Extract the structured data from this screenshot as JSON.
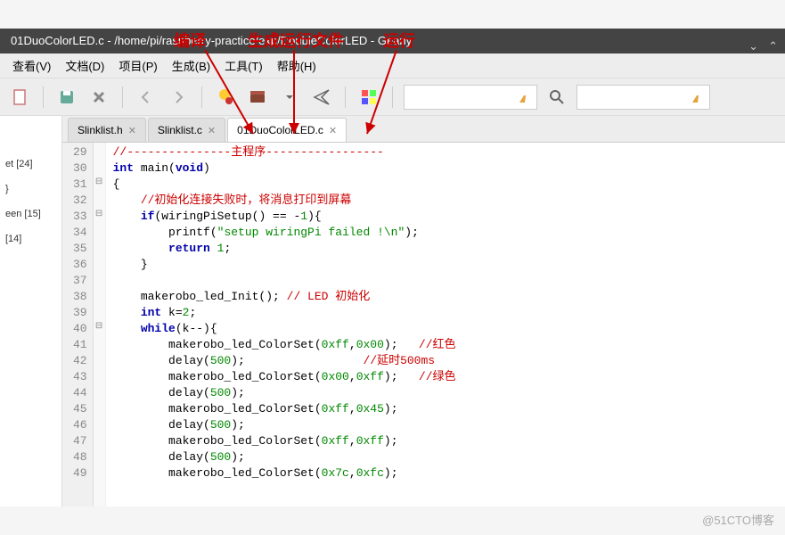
{
  "annotations": {
    "compile": "编译",
    "build": "生成运行文件",
    "run": "运行"
  },
  "titlebar": "01DuoColorLED.c - /home/pi/raspberry-practice/exp/DoubleColorLED - Geany",
  "menu": {
    "view": "查看(V)",
    "doc": "文档(D)",
    "project": "项目(P)",
    "build": "生成(B)",
    "tools": "工具(T)",
    "help": "帮助(H)"
  },
  "sidebar": {
    "items": [
      "et [24]",
      "}",
      "een [15]",
      " [14]"
    ]
  },
  "tabs": [
    {
      "label": "Slinklist.h",
      "active": false
    },
    {
      "label": "Slinklist.c",
      "active": false
    },
    {
      "label": "01DuoColorLED.c",
      "active": true
    }
  ],
  "code": {
    "start": 29,
    "lines": [
      {
        "fold": "",
        "seg": [
          {
            "c": "cm",
            "t": "//---------------主程序-----------------"
          }
        ]
      },
      {
        "fold": "",
        "seg": [
          {
            "c": "kw",
            "t": "int"
          },
          {
            "c": "",
            "t": " main("
          },
          {
            "c": "kw",
            "t": "void"
          },
          {
            "c": "",
            "t": ")"
          }
        ]
      },
      {
        "fold": "⊟",
        "seg": [
          {
            "c": "",
            "t": "{"
          }
        ]
      },
      {
        "fold": "",
        "seg": [
          {
            "c": "",
            "t": "    "
          },
          {
            "c": "cm",
            "t": "//初始化连接失败时，将消息打印到屏幕"
          }
        ]
      },
      {
        "fold": "⊟",
        "seg": [
          {
            "c": "",
            "t": "    "
          },
          {
            "c": "kw",
            "t": "if"
          },
          {
            "c": "",
            "t": "(wiringPiSetup() == -"
          },
          {
            "c": "num",
            "t": "1"
          },
          {
            "c": "",
            "t": "){"
          }
        ]
      },
      {
        "fold": "",
        "seg": [
          {
            "c": "",
            "t": "        printf("
          },
          {
            "c": "str",
            "t": "\"setup wiringPi failed !\\n\""
          },
          {
            "c": "",
            "t": ");"
          }
        ]
      },
      {
        "fold": "",
        "seg": [
          {
            "c": "",
            "t": "        "
          },
          {
            "c": "kw",
            "t": "return"
          },
          {
            "c": "",
            "t": " "
          },
          {
            "c": "num",
            "t": "1"
          },
          {
            "c": "",
            "t": ";"
          }
        ]
      },
      {
        "fold": "",
        "seg": [
          {
            "c": "",
            "t": "    }"
          }
        ]
      },
      {
        "fold": "",
        "seg": [
          {
            "c": "",
            "t": ""
          }
        ]
      },
      {
        "fold": "",
        "seg": [
          {
            "c": "",
            "t": "    makerobo_led_Init(); "
          },
          {
            "c": "cm",
            "t": "// LED 初始化"
          }
        ]
      },
      {
        "fold": "",
        "seg": [
          {
            "c": "",
            "t": "    "
          },
          {
            "c": "kw",
            "t": "int"
          },
          {
            "c": "",
            "t": " k="
          },
          {
            "c": "num",
            "t": "2"
          },
          {
            "c": "",
            "t": ";"
          }
        ]
      },
      {
        "fold": "⊟",
        "seg": [
          {
            "c": "",
            "t": "    "
          },
          {
            "c": "kw",
            "t": "while"
          },
          {
            "c": "",
            "t": "(k--){"
          }
        ]
      },
      {
        "fold": "",
        "seg": [
          {
            "c": "",
            "t": "        makerobo_led_ColorSet("
          },
          {
            "c": "num",
            "t": "0xff"
          },
          {
            "c": "",
            "t": ","
          },
          {
            "c": "num",
            "t": "0x00"
          },
          {
            "c": "",
            "t": ");   "
          },
          {
            "c": "cm",
            "t": "//红色"
          }
        ]
      },
      {
        "fold": "",
        "seg": [
          {
            "c": "",
            "t": "        delay("
          },
          {
            "c": "num",
            "t": "500"
          },
          {
            "c": "",
            "t": ");                 "
          },
          {
            "c": "cm",
            "t": "//延时500ms"
          }
        ]
      },
      {
        "fold": "",
        "seg": [
          {
            "c": "",
            "t": "        makerobo_led_ColorSet("
          },
          {
            "c": "num",
            "t": "0x00"
          },
          {
            "c": "",
            "t": ","
          },
          {
            "c": "num",
            "t": "0xff"
          },
          {
            "c": "",
            "t": ");   "
          },
          {
            "c": "cm",
            "t": "//绿色"
          }
        ]
      },
      {
        "fold": "",
        "seg": [
          {
            "c": "",
            "t": "        delay("
          },
          {
            "c": "num",
            "t": "500"
          },
          {
            "c": "",
            "t": ");"
          }
        ]
      },
      {
        "fold": "",
        "seg": [
          {
            "c": "",
            "t": "        makerobo_led_ColorSet("
          },
          {
            "c": "num",
            "t": "0xff"
          },
          {
            "c": "",
            "t": ","
          },
          {
            "c": "num",
            "t": "0x45"
          },
          {
            "c": "",
            "t": ");"
          }
        ]
      },
      {
        "fold": "",
        "seg": [
          {
            "c": "",
            "t": "        delay("
          },
          {
            "c": "num",
            "t": "500"
          },
          {
            "c": "",
            "t": ");"
          }
        ]
      },
      {
        "fold": "",
        "seg": [
          {
            "c": "",
            "t": "        makerobo_led_ColorSet("
          },
          {
            "c": "num",
            "t": "0xff"
          },
          {
            "c": "",
            "t": ","
          },
          {
            "c": "num",
            "t": "0xff"
          },
          {
            "c": "",
            "t": ");"
          }
        ]
      },
      {
        "fold": "",
        "seg": [
          {
            "c": "",
            "t": "        delay("
          },
          {
            "c": "num",
            "t": "500"
          },
          {
            "c": "",
            "t": ");"
          }
        ]
      },
      {
        "fold": "",
        "seg": [
          {
            "c": "",
            "t": "        makerobo_led_ColorSet("
          },
          {
            "c": "num",
            "t": "0x7c"
          },
          {
            "c": "",
            "t": ","
          },
          {
            "c": "num",
            "t": "0xfc"
          },
          {
            "c": "",
            "t": ");"
          }
        ]
      }
    ]
  },
  "watermark": "@51CTO博客"
}
